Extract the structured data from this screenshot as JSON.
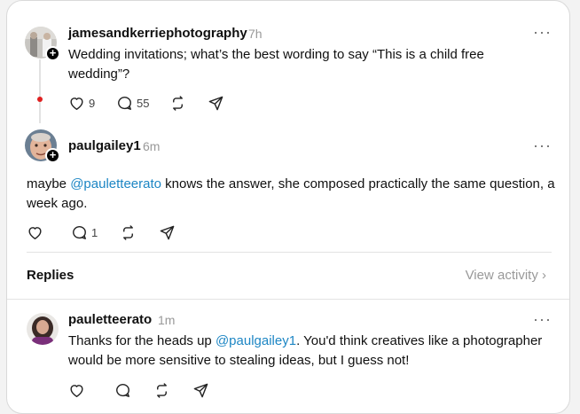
{
  "original_post": {
    "username": "jamesandkerriephotography",
    "time": "7h",
    "text": "Wedding invitations; what’s the best wording to say “This is a child free wedding”?",
    "likes": "9",
    "replies": "55",
    "more_icon": "more-horizontal"
  },
  "reply_post": {
    "username": "paulgailey1",
    "time": "6m",
    "text_before": "maybe ",
    "mention": "@pauletteerato",
    "text_after": " knows the answer, she composed practically the same question, a week ago.",
    "likes": "",
    "replies": "1"
  },
  "replies_section": {
    "title": "Replies",
    "view_activity": "View activity ›"
  },
  "nested_reply": {
    "username": "pauletteerato",
    "time": "1m",
    "text_before": "Thanks for the heads up ",
    "mention": "@paulgailey1",
    "text_after": ". You'd think creatives like a photographer would be more sensitive to stealing ideas, but I guess not!"
  },
  "colors": {
    "mention": "#1d86c4",
    "thread_dot": "#e02020",
    "muted": "#999999"
  }
}
